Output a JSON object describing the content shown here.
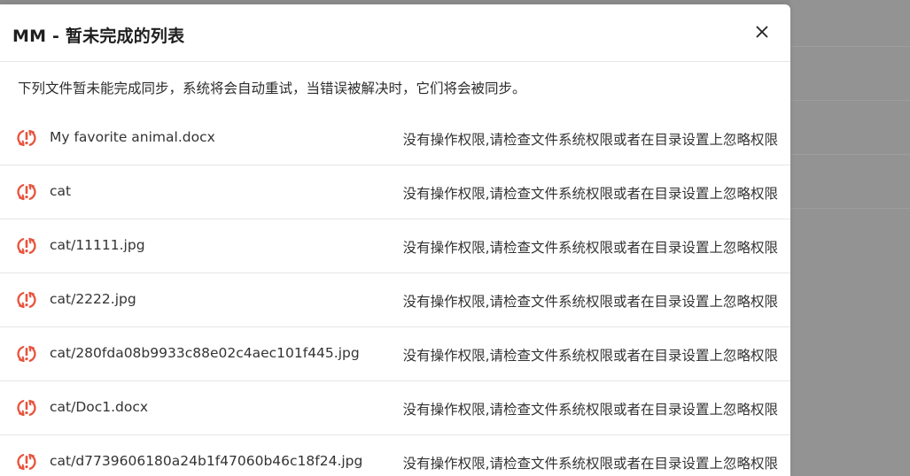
{
  "dialog": {
    "title": "MM - 暂未完成的列表",
    "description": "下列文件暂未能完成同步，系统将会自动重试，当错误被解决时，它们将会被同步。",
    "close_icon": "close-icon",
    "row_icon": "sync-error-icon"
  },
  "colors": {
    "accent_error": "#e8543e",
    "overlay": "#8f8f8f"
  },
  "files": [
    {
      "name": "My favorite animal.docx",
      "error": "没有操作权限,请检查文件系统权限或者在目录设置上忽略权限"
    },
    {
      "name": "cat",
      "error": "没有操作权限,请检查文件系统权限或者在目录设置上忽略权限"
    },
    {
      "name": "cat/11111.jpg",
      "error": "没有操作权限,请检查文件系统权限或者在目录设置上忽略权限"
    },
    {
      "name": "cat/2222.jpg",
      "error": "没有操作权限,请检查文件系统权限或者在目录设置上忽略权限"
    },
    {
      "name": "cat/280fda08b9933c88e02c4aec101f445.jpg",
      "error": "没有操作权限,请检查文件系统权限或者在目录设置上忽略权限"
    },
    {
      "name": "cat/Doc1.docx",
      "error": "没有操作权限,请检查文件系统权限或者在目录设置上忽略权限"
    },
    {
      "name": "cat/d7739606180a24b1f47060b46c18f24.jpg",
      "error": "没有操作权限,请检查文件系统权限或者在目录设置上忽略权限"
    }
  ]
}
